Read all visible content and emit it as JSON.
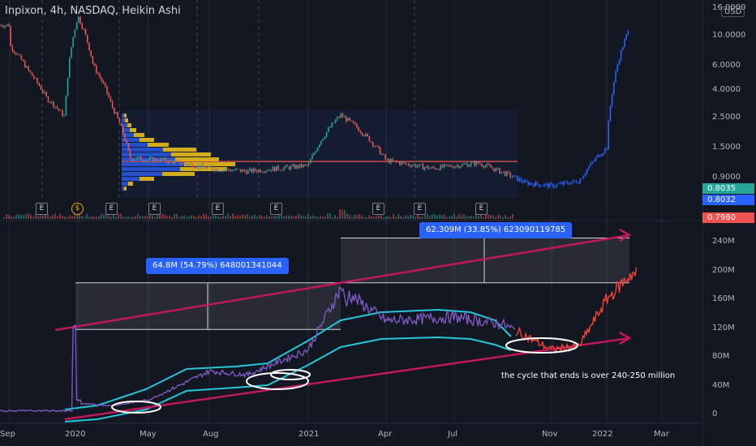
{
  "header": {
    "title": "Inpixon, 4h, NASDAQ, Heikin Ashi",
    "currency": "USD"
  },
  "price_boxes": [
    {
      "value": "0.8035",
      "color": "#26a69a"
    },
    {
      "value": "0.8032",
      "color": "#2962ff"
    },
    {
      "value": "0.7980",
      "color": "#ef5350"
    }
  ],
  "events": [
    {
      "label": "E",
      "kind": "earnings"
    },
    {
      "label": "$",
      "kind": "dividend"
    },
    {
      "label": "E",
      "kind": "earnings"
    },
    {
      "label": "E",
      "kind": "earnings"
    },
    {
      "label": "E",
      "kind": "earnings"
    },
    {
      "label": "E",
      "kind": "earnings"
    },
    {
      "label": "E",
      "kind": "earnings"
    },
    {
      "label": "E",
      "kind": "earnings"
    },
    {
      "label": "E",
      "kind": "earnings"
    }
  ],
  "measures": [
    {
      "text": "64.8M  (54.79%)  648001341044"
    },
    {
      "text": "62.309M  (33.85%)  623090119785"
    }
  ],
  "annotation": "the cycle that ends is over 240-250 million",
  "colors": {
    "background": "#131722",
    "up": "#26a69a",
    "down": "#ef5350",
    "projection": "#2962ff",
    "indicator": "#7e57c2",
    "bands": "#26c6da",
    "trendline": "#c2185b",
    "projection_red": "#f44336"
  },
  "chart_data": [
    {
      "type": "line",
      "panel": "price",
      "title": "Inpixon, 4h, NASDAQ, Heikin Ashi",
      "y_scale": "log",
      "ytick_labels": [
        "16.0000",
        "10.0000",
        "6.0000",
        "4.0000",
        "2.5000",
        "1.5000",
        "0.9000"
      ],
      "ytick_values": [
        16,
        10,
        6,
        4,
        2.5,
        1.5,
        0.9
      ],
      "ylim": [
        0.72,
        16
      ],
      "x": [
        "2019-09",
        "2019-10",
        "2019-11",
        "2019-12",
        "2020-01",
        "2020-02",
        "2020-03",
        "2020-04",
        "2020-06",
        "2020-08",
        "2020-10",
        "2021-01",
        "2021-02",
        "2021-04",
        "2021-06",
        "2021-08",
        "2021-10",
        "2021-11",
        "2021-12",
        "2022-01",
        "2022-02"
      ],
      "series": [
        {
          "values": [
            8.5,
            5.5,
            3.5,
            2.5,
            14,
            6,
            3.0,
            1.25,
            1.2,
            1.05,
            1.0,
            1.1,
            2.6,
            1.2,
            1.05,
            1.15,
            0.82,
            0.78,
            0.85,
            1.5,
            12
          ]
        }
      ],
      "horizontal_line": 1.18,
      "current_values": [
        0.8035,
        0.8032,
        0.798
      ]
    },
    {
      "type": "line",
      "panel": "indicator",
      "yaxis_ticks": [
        "240M",
        "200M",
        "160M",
        "120M",
        "80M",
        "40M",
        "0"
      ],
      "ylim": [
        -10,
        270
      ],
      "xtick_labels": [
        "Sep",
        "2020",
        "May",
        "Aug",
        "2021",
        "Apr",
        "Jul",
        "Nov",
        "2022",
        "Mar"
      ],
      "x": [
        "2019-09",
        "2019-12",
        "2020-01",
        "2020-03",
        "2020-05",
        "2020-08",
        "2020-10",
        "2021-01",
        "2021-02",
        "2021-04",
        "2021-07",
        "2021-09",
        "2021-11",
        "2021-12",
        "2022-01",
        "2022-02"
      ],
      "series": [
        {
          "values": [
            4,
            5,
            15,
            12,
            20,
            60,
            55,
            90,
            175,
            130,
            135,
            125,
            90,
            95,
            160,
            195
          ]
        }
      ],
      "measurements": [
        {
          "from": 118,
          "to": 182.8,
          "change": "64.8M",
          "percent": "54.79%"
        },
        {
          "from": 182.8,
          "to": 245.1,
          "change": "62.309M",
          "percent": "33.85%"
        }
      ]
    }
  ]
}
